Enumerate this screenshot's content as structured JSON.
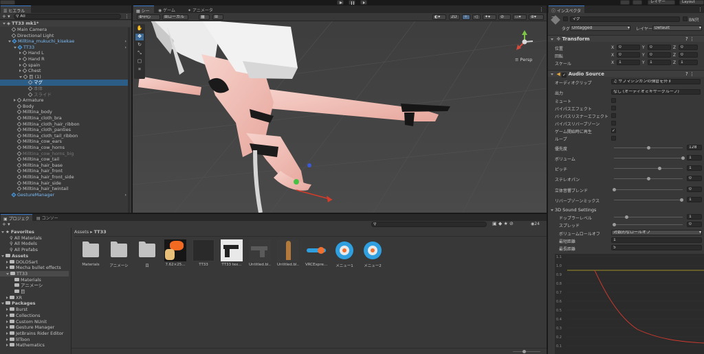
{
  "toolbar": {
    "layers_label": "レイヤー",
    "layout_label": "Layout"
  },
  "hierarchy": {
    "tab": "ヒエラルキー",
    "search_placeholder": "All",
    "scene_name": "TT33 mk1*",
    "items": [
      {
        "label": "Main Camera",
        "depth": 1,
        "style": "normal",
        "arrow": "none",
        "icon": "cube"
      },
      {
        "label": "Directional Light",
        "depth": 1,
        "style": "normal",
        "arrow": "none",
        "icon": "cube"
      },
      {
        "label": "Milltina_mukuchi_kisekae",
        "depth": 1,
        "style": "blue",
        "arrow": "down",
        "icon": "prefab"
      },
      {
        "label": "TT33",
        "depth": 2,
        "style": "blue",
        "arrow": "down",
        "icon": "prefab"
      },
      {
        "label": "Hand L",
        "depth": 3,
        "style": "normal",
        "arrow": "right",
        "icon": "cube"
      },
      {
        "label": "Hand R",
        "depth": 3,
        "style": "normal",
        "arrow": "right",
        "icon": "cube"
      },
      {
        "label": "spain",
        "depth": 3,
        "style": "normal",
        "arrow": "right",
        "icon": "cube"
      },
      {
        "label": "Chest",
        "depth": 3,
        "style": "normal",
        "arrow": "right",
        "icon": "cube"
      },
      {
        "label": "目 (1)",
        "depth": 3,
        "style": "normal",
        "arrow": "down",
        "icon": "cube"
      },
      {
        "label": "マグ",
        "depth": 4,
        "style": "selected",
        "arrow": "none",
        "icon": "cube"
      },
      {
        "label": "本体",
        "depth": 4,
        "style": "grey",
        "arrow": "none",
        "icon": "cube"
      },
      {
        "label": "スライド",
        "depth": 4,
        "style": "grey",
        "arrow": "none",
        "icon": "cube"
      },
      {
        "label": "Armature",
        "depth": 2,
        "style": "normal",
        "arrow": "right",
        "icon": "cube"
      },
      {
        "label": "Body",
        "depth": 2,
        "style": "normal",
        "arrow": "none",
        "icon": "cube"
      },
      {
        "label": "Milltina_body",
        "depth": 2,
        "style": "normal",
        "arrow": "none",
        "icon": "cube"
      },
      {
        "label": "Milltina_cloth_bra",
        "depth": 2,
        "style": "normal",
        "arrow": "none",
        "icon": "cube"
      },
      {
        "label": "Milltina_cloth_hair_ribbon",
        "depth": 2,
        "style": "normal",
        "arrow": "none",
        "icon": "cube"
      },
      {
        "label": "Milltina_cloth_panties",
        "depth": 2,
        "style": "normal",
        "arrow": "none",
        "icon": "cube"
      },
      {
        "label": "Milltina_cloth_tail_ribbon",
        "depth": 2,
        "style": "normal",
        "arrow": "none",
        "icon": "cube"
      },
      {
        "label": "Milltina_cow_ears",
        "depth": 2,
        "style": "normal",
        "arrow": "none",
        "icon": "cube"
      },
      {
        "label": "Milltina_cow_horns",
        "depth": 2,
        "style": "normal",
        "arrow": "none",
        "icon": "cube"
      },
      {
        "label": "Milltina_cow_horns_big",
        "depth": 2,
        "style": "grey",
        "arrow": "none",
        "icon": "cube"
      },
      {
        "label": "Milltina_cow_tail",
        "depth": 2,
        "style": "normal",
        "arrow": "none",
        "icon": "cube"
      },
      {
        "label": "Milltina_hair_base",
        "depth": 2,
        "style": "normal",
        "arrow": "none",
        "icon": "cube"
      },
      {
        "label": "Milltina_hair_front",
        "depth": 2,
        "style": "normal",
        "arrow": "none",
        "icon": "cube"
      },
      {
        "label": "Milltina_hair_front_side",
        "depth": 2,
        "style": "normal",
        "arrow": "none",
        "icon": "cube"
      },
      {
        "label": "Milltina_hair_side",
        "depth": 2,
        "style": "normal",
        "arrow": "none",
        "icon": "cube"
      },
      {
        "label": "Milltina_hair_twintail",
        "depth": 2,
        "style": "normal",
        "arrow": "none",
        "icon": "cube"
      },
      {
        "label": "GestureManager",
        "depth": 1,
        "style": "blue",
        "arrow": "none",
        "icon": "prefab"
      }
    ]
  },
  "scene": {
    "tab_scene": "シーン",
    "tab_game": "ゲーム",
    "tab_animator": "アニメーター",
    "pivot_label": "中心",
    "space_label": "ローカル",
    "mode_2d": "2D",
    "persp_label": "Persp"
  },
  "inspector": {
    "tab": "インスペクター",
    "object_name": "マグ",
    "static_label": "BN只",
    "tag_label": "タグ",
    "tag_value": "Untagged",
    "layer_label": "レイヤー",
    "layer_value": "Default",
    "transform": {
      "title": "Transform",
      "position_label": "位置",
      "rotation_label": "回転",
      "scale_label": "スケール",
      "position": [
        "0",
        "0",
        "0"
      ],
      "rotation": [
        "0",
        "0",
        "0"
      ],
      "scale": [
        "1",
        "1",
        "1"
      ],
      "axis_x": "X",
      "axis_y": "Y",
      "axis_z": "Z"
    },
    "audio": {
      "title": "Audio Source",
      "clip_label": "オーディオクリップ",
      "clip_value": "サブマシンガンの弾倉を外す",
      "output_label": "出力",
      "output_value": "なし (オーディオミキサーグループ)",
      "mute_label": "ミュート",
      "bypass_effects_label": "バイパスエフェクト",
      "bypass_listener_label": "バイパスリスナーエフェクト",
      "bypass_reverb_label": "バイパスリバーブゾーン",
      "play_on_awake_label": "ゲーム開始時に再生",
      "play_on_awake": true,
      "loop_label": "ループ",
      "priority_label": "優先度",
      "priority_value": "128",
      "priority_fraction": 0.5,
      "volume_label": "ボリューム",
      "volume_value": "1",
      "pitch_label": "ピッチ",
      "pitch_value": "1",
      "stereo_label": "ステレオパン",
      "stereo_value": "0",
      "spatial_label": "立体音響ブレンド",
      "spatial_value": "0",
      "reverb_label": "リバーブゾーンミックス",
      "reverb_value": "1",
      "sound3d_title": "3D Sound Settings",
      "doppler_label": "ドップラーレベル",
      "doppler_value": "1",
      "spread_label": "スプレッド",
      "spread_value": "0",
      "rolloff_label": "ボリュームロールオフ",
      "rolloff_value": "対数的なロールオフ",
      "min_label": "最短距離",
      "min_value": "1",
      "max_label": "最長距離",
      "max_value": "5"
    },
    "graph_ticks": [
      "1.1",
      "1.0",
      "0.9",
      "0.8",
      "0.7",
      "0.6",
      "0.5",
      "0.4",
      "0.3",
      "0.2",
      "0.1"
    ]
  },
  "project": {
    "tab_project": "プロジェクト",
    "tab_console": "コンソール",
    "breadcrumb_root": "Assets",
    "breadcrumb_current": "TT33",
    "hidden_count": "24",
    "tree": [
      {
        "label": "Favorites",
        "bold": true,
        "depth": 0
      },
      {
        "label": "All Materials",
        "bold": false,
        "depth": 1
      },
      {
        "label": "All Models",
        "bold": false,
        "depth": 1
      },
      {
        "label": "All Prefabs",
        "bold": false,
        "depth": 1
      },
      {
        "label": "Assets",
        "bold": true,
        "depth": 0
      },
      {
        "label": "DOLOSart",
        "bold": false,
        "depth": 1
      },
      {
        "label": "Mecha bullet effects",
        "bold": false,
        "depth": 1
      },
      {
        "label": "TT33",
        "bold": false,
        "depth": 1
      },
      {
        "label": "Materials",
        "bold": false,
        "depth": 2
      },
      {
        "label": "アニメーシ",
        "bold": false,
        "depth": 2
      },
      {
        "label": "目",
        "bold": false,
        "depth": 2
      },
      {
        "label": "XR",
        "bold": false,
        "depth": 1
      },
      {
        "label": "Packages",
        "bold": true,
        "depth": 0
      },
      {
        "label": "Burst",
        "bold": false,
        "depth": 1
      },
      {
        "label": "Collections",
        "bold": false,
        "depth": 1
      },
      {
        "label": "Custom NUnit",
        "bold": false,
        "depth": 1
      },
      {
        "label": "Gesture Manager",
        "bold": false,
        "depth": 1
      },
      {
        "label": "JetBrains Rider Editor",
        "bold": false,
        "depth": 1
      },
      {
        "label": "lilToon",
        "bold": false,
        "depth": 1
      },
      {
        "label": "Mathematics",
        "bold": false,
        "depth": 1
      }
    ],
    "assets": [
      {
        "label": "Materials",
        "kind": "folder"
      },
      {
        "label": "アニメーシ",
        "kind": "folder"
      },
      {
        "label": "目",
        "kind": "folder"
      },
      {
        "label": "7.62×25...",
        "kind": "texture"
      },
      {
        "label": "TT33",
        "kind": "prefab"
      },
      {
        "label": "TT33 tex...",
        "kind": "gun"
      },
      {
        "label": "Untitled.bl...",
        "kind": "pistol"
      },
      {
        "label": "Untitled.bl...",
        "kind": "bullet"
      },
      {
        "label": "VRCExpre...",
        "kind": "param"
      },
      {
        "label": "メニュー1",
        "kind": "menu"
      },
      {
        "label": "メニュー2",
        "kind": "menu"
      }
    ]
  },
  "colors": {
    "accent": "#3a78c8",
    "selection": "#2c5d87",
    "prefab_blue": "#7bbcf5",
    "curve_red": "#d03a2e",
    "curve_yellow": "#c8b42a"
  }
}
